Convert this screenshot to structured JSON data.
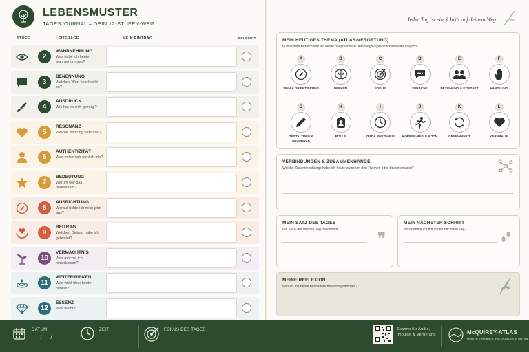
{
  "header": {
    "title": "LEBENSMUSTER",
    "subtitle": "TAGESJOURNAL – DEIN 12-STUFEN-WEG"
  },
  "columns": {
    "stufe": "STUFE",
    "leitfrage": "LEITFRAGE",
    "eintrag": "MEIN EINTRAG",
    "erledigt": "ERLEDIGT"
  },
  "steps": [
    {
      "num": "2",
      "name": "WAHRNEHMUNG",
      "question": "Was habe ich heute wahrgenommen?",
      "color": "#2e4a2f",
      "icon": "eye-icon"
    },
    {
      "num": "3",
      "name": "BENENNUNG",
      "question": "Welches Wort beschreibt es?",
      "color": "#2e4a2f",
      "icon": "speech-bubble-icon"
    },
    {
      "num": "4",
      "name": "AUSDRUCK",
      "question": "Wie hat es sich gezeigt?",
      "color": "#2e4a2f",
      "icon": "brush-icon"
    },
    {
      "num": "5",
      "name": "RESONANZ",
      "question": "Welche Wirkung entstand?",
      "color": "#d89a3a",
      "icon": "heart-icon"
    },
    {
      "num": "6",
      "name": "AUTHENTIZITÄT",
      "question": "Was entsprach wirklich mir?",
      "color": "#d89a3a",
      "icon": "person-icon"
    },
    {
      "num": "7",
      "name": "BEDEUTUNG",
      "question": "Warum war das bedeutsam?",
      "color": "#d89a3a",
      "icon": "star-icon"
    },
    {
      "num": "8",
      "name": "AUSRICHTUNG",
      "question": "Worauf richte ich mich jetzt aus?",
      "color": "#d0603e",
      "icon": "compass-icon"
    },
    {
      "num": "9",
      "name": "BEITRAG",
      "question": "Welchen Beitrag habe ich geleistet?",
      "color": "#d0603e",
      "icon": "hands-heart-icon"
    },
    {
      "num": "10",
      "name": "VERMÄCHTNIS",
      "question": "Was möchte ich hinterlassen?",
      "color": "#7a4f7e",
      "icon": "sprout-icon"
    },
    {
      "num": "11",
      "name": "WEITERWIRKEN",
      "question": "Was wirkt über heute hinaus?",
      "color": "#2d6d7a",
      "icon": "ripple-icon"
    },
    {
      "num": "12",
      "name": "ESSENZ",
      "question": "Was bleibt?",
      "color": "#2d6d7a",
      "icon": "diamond-icon"
    }
  ],
  "motto": "Jeder Tag ist ein Schritt auf deinem Weg.",
  "theme_card": {
    "title": "MEIN HEUTIGES THEMA (ATLAS-VERORTUNG)",
    "subtitle": "In welchem Bereich war ich heute hauptsächlich unterwegs? (Mehrfachauswahl möglich)",
    "items": [
      {
        "letter": "A",
        "label": "SINN & ORIENTIERUNG",
        "icon": "compass-icon"
      },
      {
        "letter": "B",
        "label": "DENKEN",
        "icon": "brain-icon"
      },
      {
        "letter": "C",
        "label": "FOKUS",
        "icon": "target-icon"
      },
      {
        "letter": "D",
        "label": "SPRACHE",
        "icon": "speech-bubble-icon"
      },
      {
        "letter": "E",
        "label": "BEZIEHUNG & KONTAKT",
        "icon": "people-icon"
      },
      {
        "letter": "F",
        "label": "HANDLUNG",
        "icon": "hand-icon"
      },
      {
        "letter": "G",
        "label": "GESTALTUNG & AUSDRUCK",
        "icon": "pencil-icon"
      },
      {
        "letter": "H",
        "label": "ROLLE",
        "icon": "person-badge-icon"
      },
      {
        "letter": "I",
        "label": "ZEIT & RHYTHMUS",
        "icon": "clock-icon"
      },
      {
        "letter": "J",
        "label": "KÖRPER-REGULATION",
        "icon": "running-icon"
      },
      {
        "letter": "K",
        "label": "GEWOHNHEIT",
        "icon": "cycle-icon"
      },
      {
        "letter": "L",
        "label": "KERNRAUM",
        "icon": "heart-icon"
      }
    ]
  },
  "connections": {
    "title": "VERBINDUNGEN & ZUSAMMENHÄNGE",
    "subtitle": "Welche Zusammenhänge habe ich heute zwischen den Themen oder Stufen erkannt?"
  },
  "satz": {
    "title": "MEIN SATZ DES TAGES",
    "subtitle": "Ein Satz, der meinen Tag beschreibt."
  },
  "schritt": {
    "title": "MEIN NÄCHSTER SCHRITT",
    "subtitle": "Was nehme ich mit in den nächsten Tag?"
  },
  "reflexion": {
    "title": "MEINE REFLEXION",
    "subtitle": "Was ist mir heute besonders bewusst geworden?"
  },
  "footer": {
    "datum_label": "DATUM",
    "datum_placeholder": "___/___/_____",
    "zeit_label": "ZEIT",
    "fokus_label": "FOKUS DES TAGES",
    "scan_text": "Scanne für Audio, Impulse & Vertiefung",
    "brand": "McQUIREY-ATLAS",
    "brand_sub": "MUSTER ERKENNEN. POTENZIALE ENTFALTEN."
  }
}
